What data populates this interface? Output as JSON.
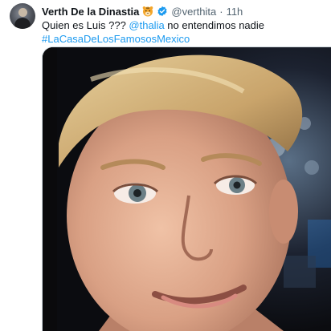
{
  "tweet": {
    "display_name": "Verth De la Dinastia",
    "name_emoji_icon": "tiger-face-icon",
    "verified_icon": "verified-badge-icon",
    "handle": "@verthita",
    "separator": "·",
    "time": "11h",
    "text_prefix": "Quien es Luis ??? ",
    "mention": "@thalia",
    "text_suffix": " no entendimos nadie",
    "hashtag": "#LaCasaDeLosFamososMexico",
    "colors": {
      "link": "#1d9bf0",
      "secondary_text": "#536471",
      "primary_text": "#0f1419"
    }
  },
  "media": {
    "type": "video-still",
    "subject": "man-blinking-meme"
  }
}
